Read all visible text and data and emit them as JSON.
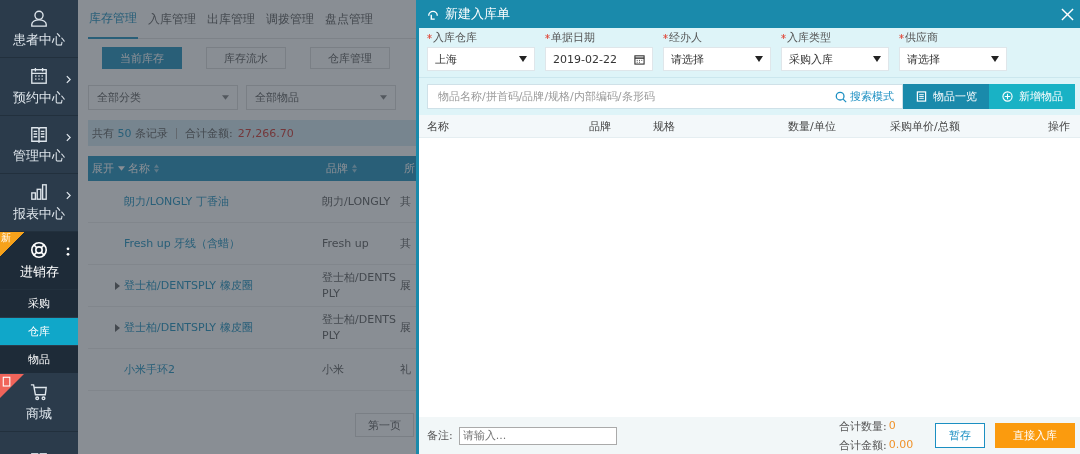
{
  "sidebar": {
    "items": [
      {
        "label": "患者中心",
        "chevron": false
      },
      {
        "label": "预约中心",
        "chevron": true
      },
      {
        "label": "管理中心",
        "chevron": true
      },
      {
        "label": "报表中心",
        "chevron": true
      },
      {
        "label": "进销存",
        "chevron": false,
        "badge": "新",
        "expanded": true,
        "children": [
          {
            "label": "采购",
            "selected": false
          },
          {
            "label": "仓库",
            "selected": true
          },
          {
            "label": "物品",
            "selected": false
          }
        ]
      },
      {
        "label": "商城",
        "chevron": false,
        "badge_icon": true
      },
      {
        "chevron": false
      }
    ]
  },
  "background": {
    "tabs": [
      {
        "label": "库存管理",
        "selected": true
      },
      {
        "label": "入库管理",
        "selected": false
      },
      {
        "label": "出库管理",
        "selected": false
      },
      {
        "label": "调拨管理",
        "selected": false
      },
      {
        "label": "盘点管理",
        "selected": false
      }
    ],
    "sub_tabs": [
      {
        "label": "当前库存",
        "selected": true
      },
      {
        "label": "库存流水",
        "selected": false
      },
      {
        "label": "仓库管理",
        "selected": false
      }
    ],
    "filters": [
      "全部分类",
      "全部物品"
    ],
    "summary": {
      "prefix": "共有",
      "count": "50",
      "suffix": "条记录",
      "total_label": "合计金额:",
      "total": "27,266.70"
    },
    "table": {
      "columns": [
        "展开",
        "名称",
        "品牌",
        "所"
      ],
      "rows": [
        {
          "expandable": false,
          "name": "朗力/LONGLY 丁香油",
          "brand": "朗力/LONGLY",
          "column_3": "其"
        },
        {
          "expandable": false,
          "name": "Fresh up 牙线（含蜡）",
          "brand": "Fresh up",
          "column_3": "其"
        },
        {
          "expandable": true,
          "name": "登士柏/DENTSPLY 橡皮圈",
          "brand": "登士柏/DENTSPLY",
          "column_3": "展"
        },
        {
          "expandable": true,
          "name": "登士柏/DENTSPLY 橡皮圈",
          "brand": "登士柏/DENTSPLY",
          "column_3": "展"
        },
        {
          "expandable": false,
          "name": "小米手环2",
          "brand": "小米",
          "column_3": "礼"
        }
      ]
    },
    "pagination": [
      "第一页"
    ]
  },
  "dialog": {
    "title": "新建入库单",
    "fields": [
      {
        "label": "入库仓库",
        "required": true,
        "kind": "select",
        "value": "上海"
      },
      {
        "label": "单据日期",
        "required": true,
        "kind": "date",
        "value": "2019-02-22"
      },
      {
        "label": "经办人",
        "required": true,
        "kind": "select",
        "value": "请选择"
      },
      {
        "label": "入库类型",
        "required": true,
        "kind": "select",
        "value": "采购入库"
      },
      {
        "label": "供应商",
        "required": true,
        "kind": "select",
        "value": "请选择"
      }
    ],
    "search": {
      "placeholder": "物品名称/拼首码/品牌/规格/内部编码/条形码",
      "mode_link": "搜索模式"
    },
    "buttons": [
      "物品一览",
      "新增物品"
    ],
    "table": {
      "columns": [
        "名称",
        "品牌",
        "规格",
        "数量/单位",
        "采购单价/总额",
        "操作"
      ]
    },
    "footer": {
      "remark_label": "备注:",
      "remark_placeholder": "请输入...",
      "qty_label": "合计数量:",
      "qty": "0",
      "amount_label": "合计金额:",
      "amount": "0.00",
      "buttons": [
        "暂存",
        "直接入库"
      ]
    }
  }
}
